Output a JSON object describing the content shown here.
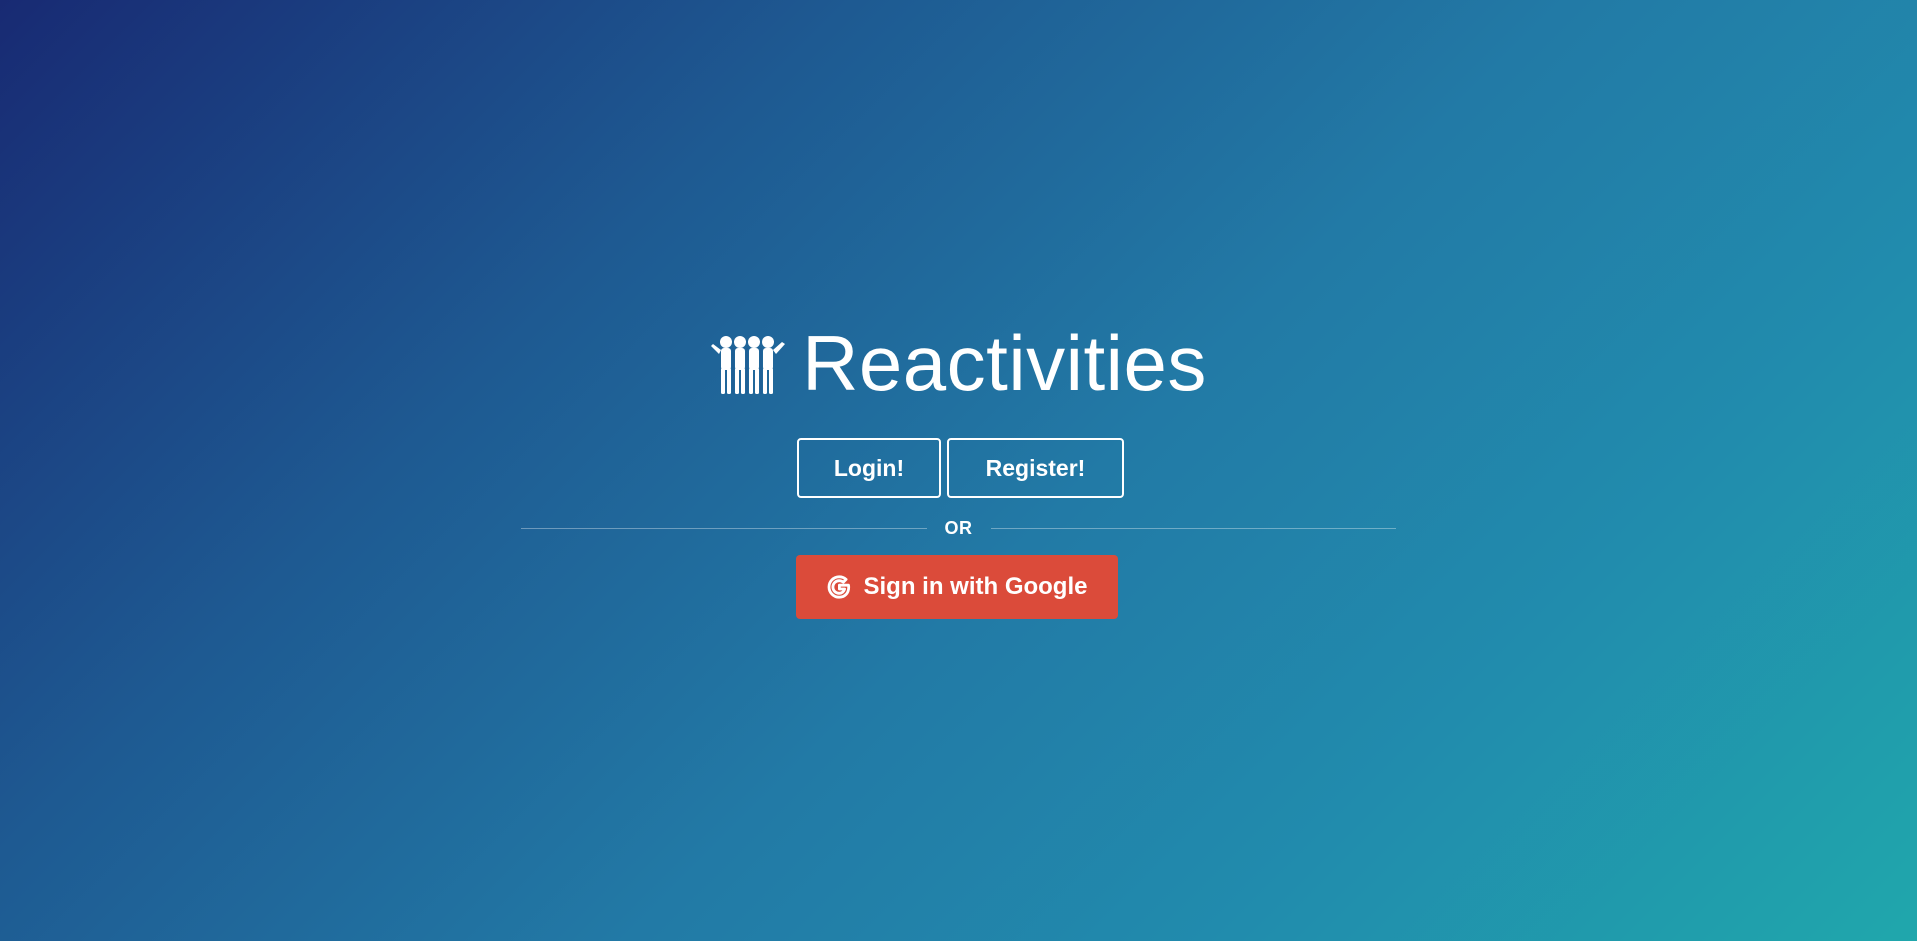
{
  "app": {
    "title": "Reactivities",
    "logo_icon": "users-icon"
  },
  "actions": {
    "login_label": "Login!",
    "register_label": "Register!",
    "divider_text": "OR",
    "google_label": "Sign in with Google",
    "google_icon": "google-icon"
  },
  "colors": {
    "gradient_start": "#182a73",
    "gradient_end": "#20a7ac",
    "google_red": "#db4b3a",
    "text": "#ffffff"
  }
}
